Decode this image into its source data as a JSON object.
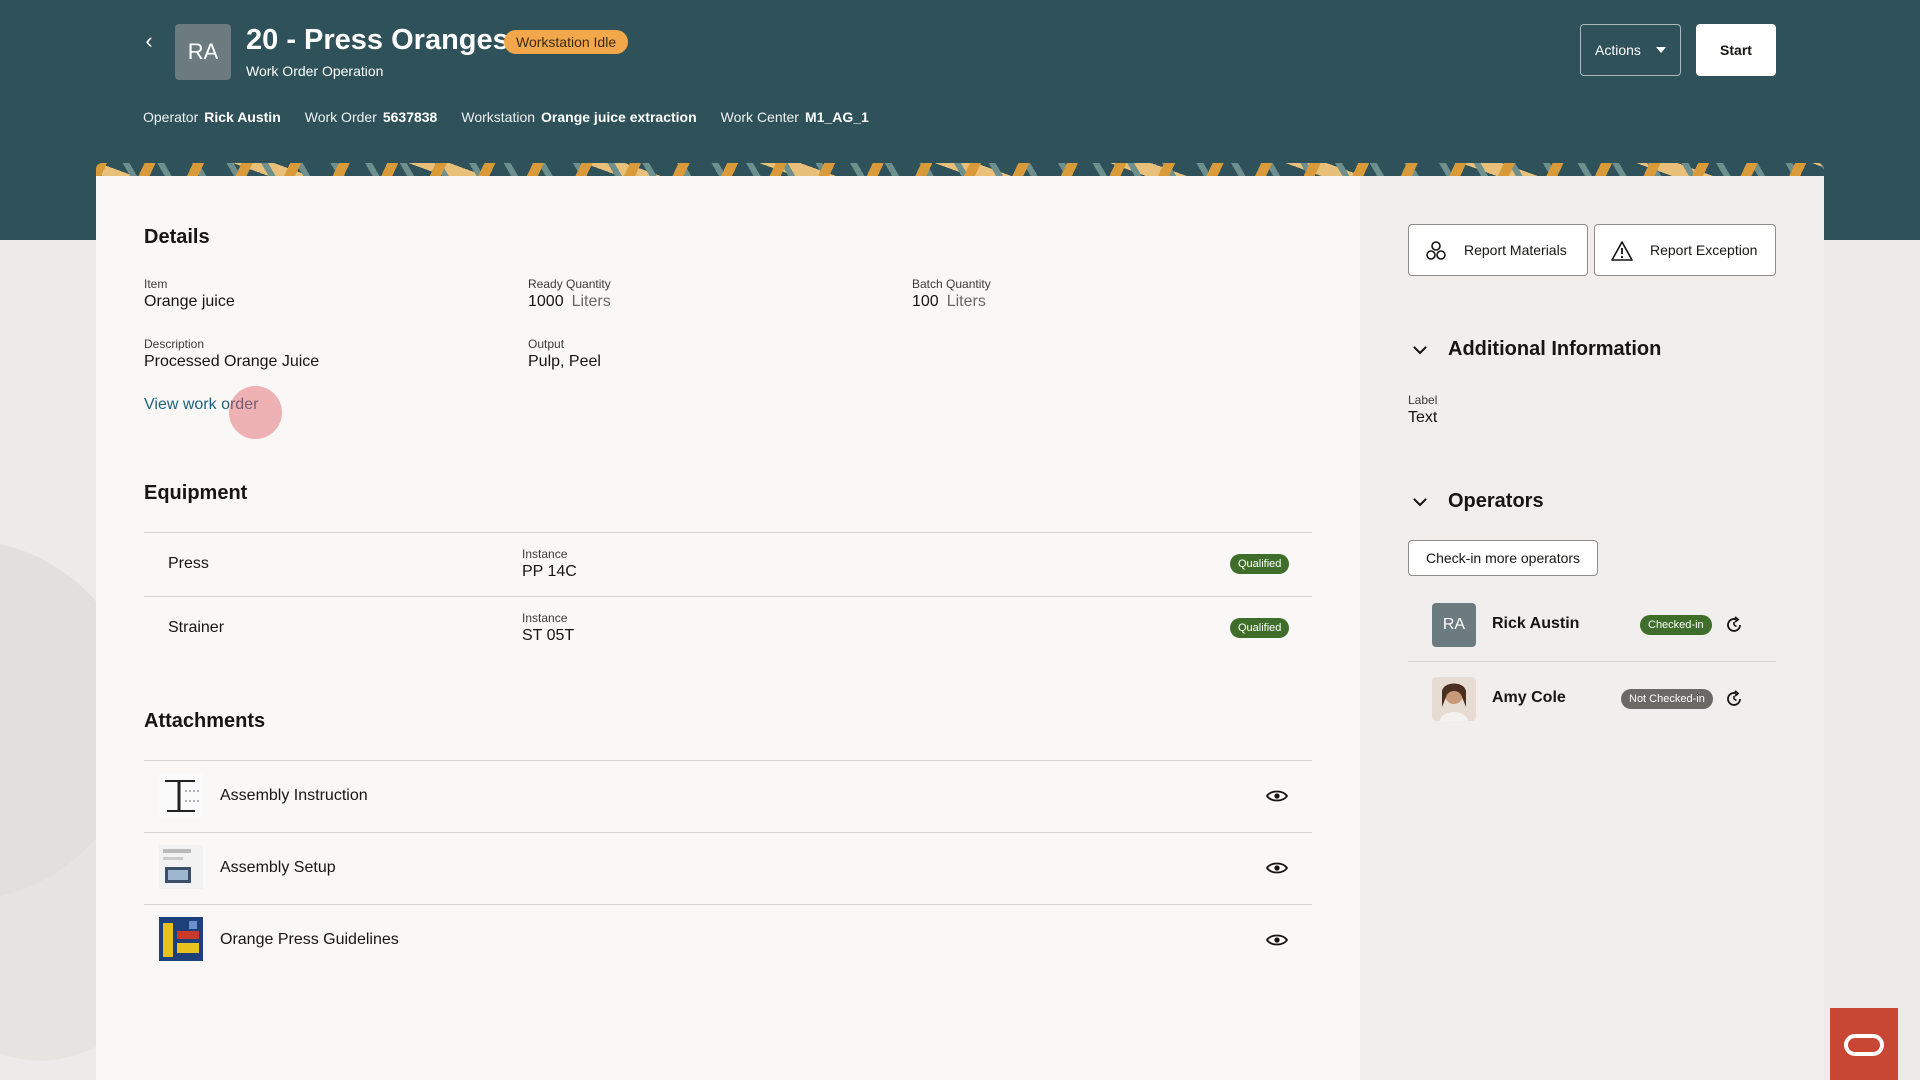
{
  "header": {
    "avatar_initials": "RA",
    "title": "20 - Press Oranges",
    "status": "Workstation Idle",
    "subtitle": "Work Order Operation",
    "meta": [
      {
        "key": "Operator",
        "value": "Rick Austin"
      },
      {
        "key": "Work Order",
        "value": "5637838"
      },
      {
        "key": "Workstation",
        "value": "Orange juice extraction"
      },
      {
        "key": "Work Center",
        "value": "M1_AG_1"
      }
    ],
    "actions_label": "Actions",
    "start_label": "Start"
  },
  "details": {
    "title": "Details",
    "item_label": "Item",
    "item_value": "Orange juice",
    "ready_qty_label": "Ready Quantity",
    "ready_qty_value": "1000",
    "ready_qty_unit": "Liters",
    "batch_qty_label": "Batch Quantity",
    "batch_qty_value": "100",
    "batch_qty_unit": "Liters",
    "description_label": "Description",
    "description_value": "Processed Orange Juice",
    "output_label": "Output",
    "output_value": "Pulp, Peel",
    "view_link": "View work order"
  },
  "equipment": {
    "title": "Equipment",
    "instance_label": "Instance",
    "rows": [
      {
        "name": "Press",
        "instance": "PP 14C",
        "badge": "Qualified"
      },
      {
        "name": "Strainer",
        "instance": "ST 05T",
        "badge": "Qualified"
      }
    ]
  },
  "attachments": {
    "title": "Attachments",
    "rows": [
      {
        "name": "Assembly Instruction",
        "icon": "assembly-instruction-thumbnail"
      },
      {
        "name": "Assembly Setup",
        "icon": "assembly-setup-thumbnail"
      },
      {
        "name": "Orange Press Guidelines",
        "icon": "orange-press-thumbnail"
      }
    ]
  },
  "side": {
    "report_materials": "Report Materials",
    "report_exception": "Report Exception",
    "additional_info_title": "Additional Information",
    "info_label": "Label",
    "info_value": "Text",
    "operators_title": "Operators",
    "checkin_more": "Check-in more operators",
    "operators": [
      {
        "initials": "RA",
        "name": "Rick Austin",
        "status": "Checked-in"
      },
      {
        "initials": "",
        "name": "Amy Cole",
        "status": "Not Checked-in"
      }
    ]
  },
  "colors": {
    "header_bg": "#2f5159",
    "status_pill": "#f2a74b",
    "link": "#20627a",
    "qualified_badge": "#3e6e2a",
    "oracle_red": "#c74634"
  }
}
